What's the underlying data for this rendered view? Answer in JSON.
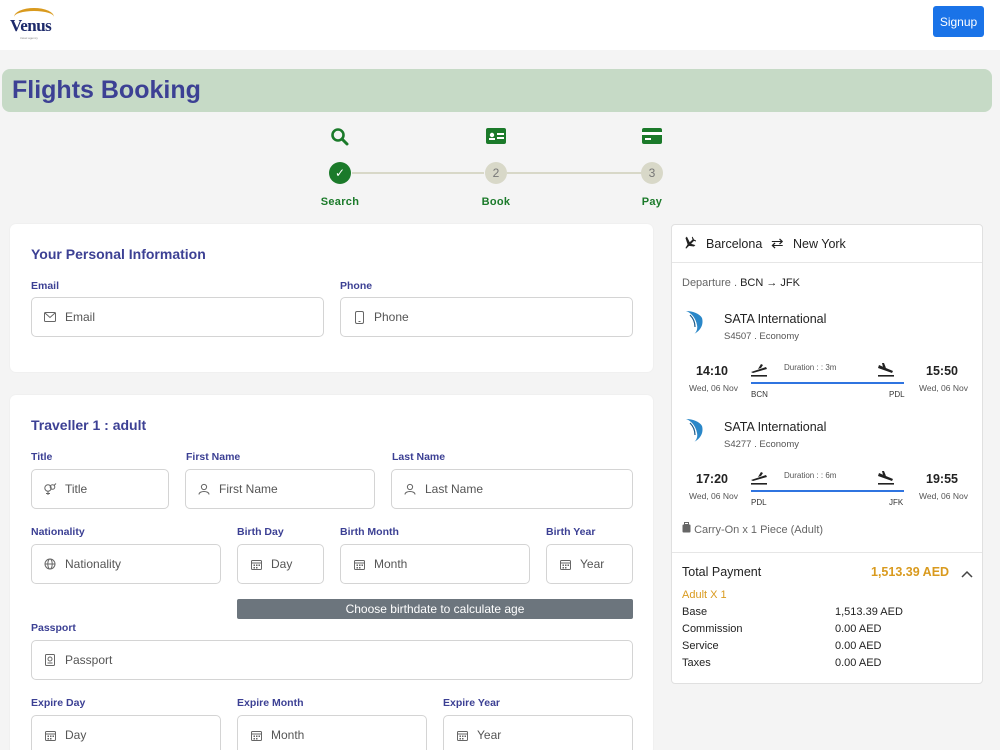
{
  "header": {
    "logo_text": "Venus",
    "logo_sub": "travel agency",
    "signup_label": "Signup"
  },
  "page_title": "Flights Booking",
  "steps": [
    {
      "label": "Search",
      "number": "✓",
      "icon": "search-icon",
      "status": "done"
    },
    {
      "label": "Book",
      "number": "2",
      "icon": "id-card-icon",
      "status": "todo"
    },
    {
      "label": "Pay",
      "number": "3",
      "icon": "credit-card-icon",
      "status": "todo"
    }
  ],
  "personal": {
    "title": "Your Personal Information",
    "email_label": "Email",
    "email_placeholder": "Email",
    "phone_label": "Phone",
    "phone_placeholder": "Phone"
  },
  "traveller": {
    "title": "Traveller 1 : adult",
    "title_label": "Title",
    "title_placeholder": "Title",
    "first_name_label": "First Name",
    "first_name_placeholder": "First Name",
    "last_name_label": "Last Name",
    "last_name_placeholder": "Last Name",
    "nationality_label": "Nationality",
    "nationality_placeholder": "Nationality",
    "birth_day_label": "Birth Day",
    "birth_day_placeholder": "Day",
    "birth_month_label": "Birth Month",
    "birth_month_placeholder": "Month",
    "birth_year_label": "Birth Year",
    "birth_year_placeholder": "Year",
    "age_hint": "Choose birthdate to calculate age",
    "passport_label": "Passport",
    "passport_placeholder": "Passport",
    "expire_day_label": "Expire Day",
    "expire_day_placeholder": "Day",
    "expire_month_label": "Expire Month",
    "expire_month_placeholder": "Month",
    "expire_year_label": "Expire Year",
    "expire_year_placeholder": "Year"
  },
  "summary": {
    "from_city": "Barcelona",
    "to_city": "New York",
    "departure_label": "Departure .",
    "route": "BCN → JFK",
    "segments": [
      {
        "airline": "SATA International",
        "flight": "S4507 . Economy",
        "dep_time": "14:10",
        "dep_date": "Wed, 06 Nov",
        "arr_time": "15:50",
        "arr_date": "Wed, 06 Nov",
        "duration": "Duration : : 3m",
        "from": "BCN",
        "to": "PDL"
      },
      {
        "airline": "SATA International",
        "flight": "S4277 . Economy",
        "dep_time": "17:20",
        "dep_date": "Wed, 06 Nov",
        "arr_time": "19:55",
        "arr_date": "Wed, 06 Nov",
        "duration": "Duration : : 6m",
        "from": "PDL",
        "to": "JFK"
      }
    ],
    "baggage": "Carry-On x 1 Piece (Adult)",
    "total_label": "Total Payment",
    "total_value": "1,513.39 AED",
    "passenger_line": "Adult X 1",
    "breakdown": [
      {
        "label": "Base",
        "value": "1,513.39 AED"
      },
      {
        "label": "Commission",
        "value": "0.00 AED"
      },
      {
        "label": "Service",
        "value": "0.00 AED"
      },
      {
        "label": "Taxes",
        "value": "0.00 AED"
      }
    ]
  },
  "colors": {
    "accent": "#3c4094",
    "green": "#1b7a2a",
    "banner": "#c6dac6",
    "total": "#d99a1e",
    "signup": "#1a73e8"
  }
}
